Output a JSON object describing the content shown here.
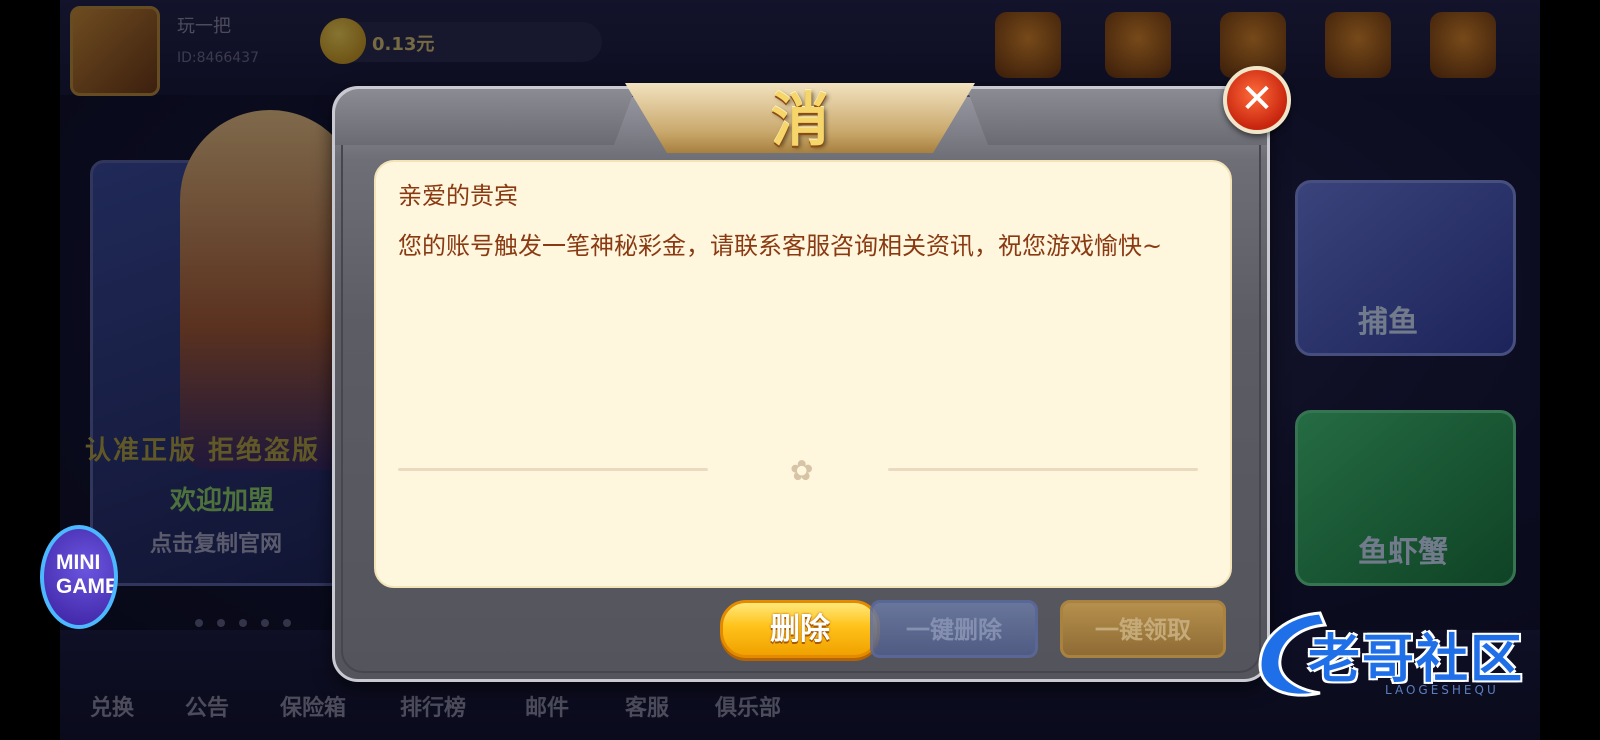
{
  "background": {
    "player_name": "玩一把",
    "player_id": "ID:8466437",
    "balance": "0.13元",
    "banner_line1": "认准正版 拒绝盗版",
    "banner_line2": "欢迎加盟",
    "banner_line3": "点击复制官网",
    "card_labels": [
      "捕鱼",
      "鱼虾蟹"
    ],
    "bottom_labels": [
      "兑换",
      "公告",
      "保险箱",
      "排行榜",
      "邮件",
      "客服",
      "俱乐部"
    ]
  },
  "minigame": {
    "label": "MINI GAME"
  },
  "dialog": {
    "title": "消息",
    "greeting": "亲爱的贵宾",
    "body": "您的账号触发一笔神秘彩金，请联系客服咨询相关资讯，祝您游戏愉快~",
    "close_label": "✕",
    "clover_icon": "✿"
  },
  "buttons": {
    "delete": "删除",
    "delete_all": "一键删除",
    "claim_all": "一键领取"
  },
  "watermark": {
    "text": "老哥社区",
    "sub": "LAOGESHEQU"
  },
  "colors": {
    "message_text": "#8a3a13",
    "panel_bg": "#fef6dd",
    "title_gold": "#f6d56a",
    "close_red": "#d7371a",
    "delete_yellow": "#ffc21a"
  }
}
